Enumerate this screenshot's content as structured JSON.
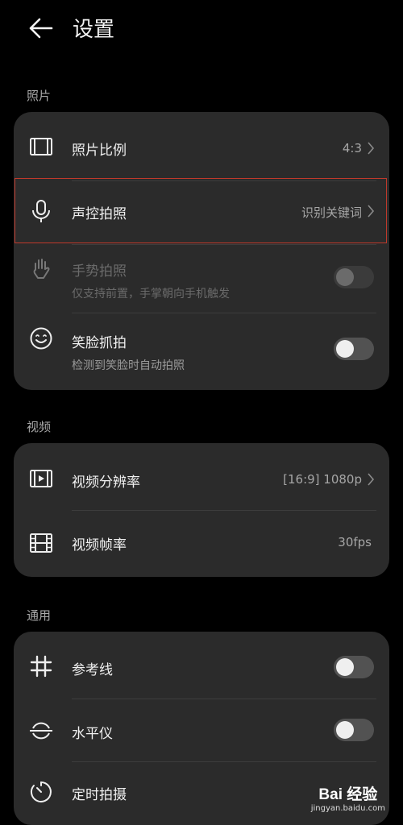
{
  "header": {
    "title": "设置"
  },
  "sections": {
    "photo": {
      "label": "照片",
      "rows": {
        "ratio": {
          "label": "照片比例",
          "value": "4:3",
          "icon": "photo-frame-icon"
        },
        "voice": {
          "label": "声控拍照",
          "value": "识别关键词",
          "icon": "microphone-icon"
        },
        "gesture": {
          "label": "手势拍照",
          "sub": "仅支持前置，手掌朝向手机触发",
          "icon": "hand-icon",
          "enabled": false,
          "on": false
        },
        "smile": {
          "label": "笑脸抓拍",
          "sub": "检测到笑脸时自动拍照",
          "icon": "smile-icon",
          "on": false
        }
      }
    },
    "video": {
      "label": "视频",
      "rows": {
        "resolution": {
          "label": "视频分辨率",
          "value": "[16:9] 1080p",
          "icon": "video-frame-icon"
        },
        "framerate": {
          "label": "视频帧率",
          "value": "30fps",
          "icon": "film-icon"
        }
      }
    },
    "general": {
      "label": "通用",
      "rows": {
        "grid": {
          "label": "参考线",
          "icon": "grid-icon",
          "on": false
        },
        "level": {
          "label": "水平仪",
          "icon": "level-icon",
          "on": false
        },
        "timer": {
          "label": "定时拍摄",
          "icon": "timer-icon"
        }
      }
    }
  },
  "watermark": {
    "brand": "Bai 经验",
    "url": "jingyan.baidu.com"
  },
  "colors": {
    "background": "#000000",
    "card": "#2b2b2b",
    "highlight": "#c0392b",
    "toggle_off": "#525252"
  }
}
